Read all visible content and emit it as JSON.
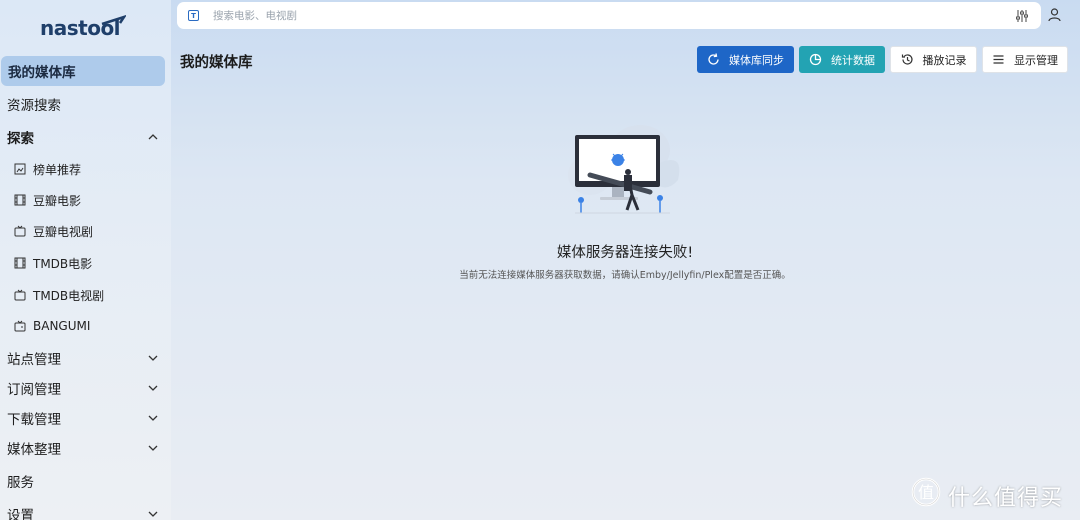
{
  "app": {
    "logo_text": "nastool"
  },
  "search": {
    "placeholder": "搜索电影、电视剧",
    "type_icon": "T"
  },
  "sidebar": {
    "items": [
      {
        "label": "我的媒体库",
        "active": true
      },
      {
        "label": "资源搜索"
      },
      {
        "label": "探索",
        "expanded": true
      },
      {
        "label": "站点管理"
      },
      {
        "label": "订阅管理"
      },
      {
        "label": "下载管理"
      },
      {
        "label": "媒体整理"
      },
      {
        "label": "服务"
      },
      {
        "label": "设置"
      }
    ],
    "explore_sub": [
      {
        "label": "榜单推荐",
        "icon": "chart-icon"
      },
      {
        "label": "豆瓣电影",
        "icon": "film-icon"
      },
      {
        "label": "豆瓣电视剧",
        "icon": "tv-icon"
      },
      {
        "label": "TMDB电影",
        "icon": "film-icon"
      },
      {
        "label": "TMDB电视剧",
        "icon": "tv-icon"
      },
      {
        "label": "BANGUMI",
        "icon": "tv-retro-icon"
      }
    ]
  },
  "header": {
    "title": "我的媒体库",
    "buttons": [
      {
        "label": "媒体库同步",
        "icon": "refresh-icon",
        "color": "#1e66c7"
      },
      {
        "label": "统计数据",
        "icon": "pie-chart-icon",
        "color": "#23a3b3"
      },
      {
        "label": "播放记录",
        "icon": "history-icon"
      },
      {
        "label": "显示管理",
        "icon": "list-icon"
      }
    ]
  },
  "empty_state": {
    "title": "媒体服务器连接失败!",
    "description": "当前无法连接媒体服务器获取数据，请确认Emby/Jellyfin/Plex配置是否正确。"
  },
  "watermark": {
    "text": "什么值得买"
  },
  "colors": {
    "accent": "#1e66c7",
    "teal": "#23a3b3",
    "active_bg": "#aecbeb"
  }
}
